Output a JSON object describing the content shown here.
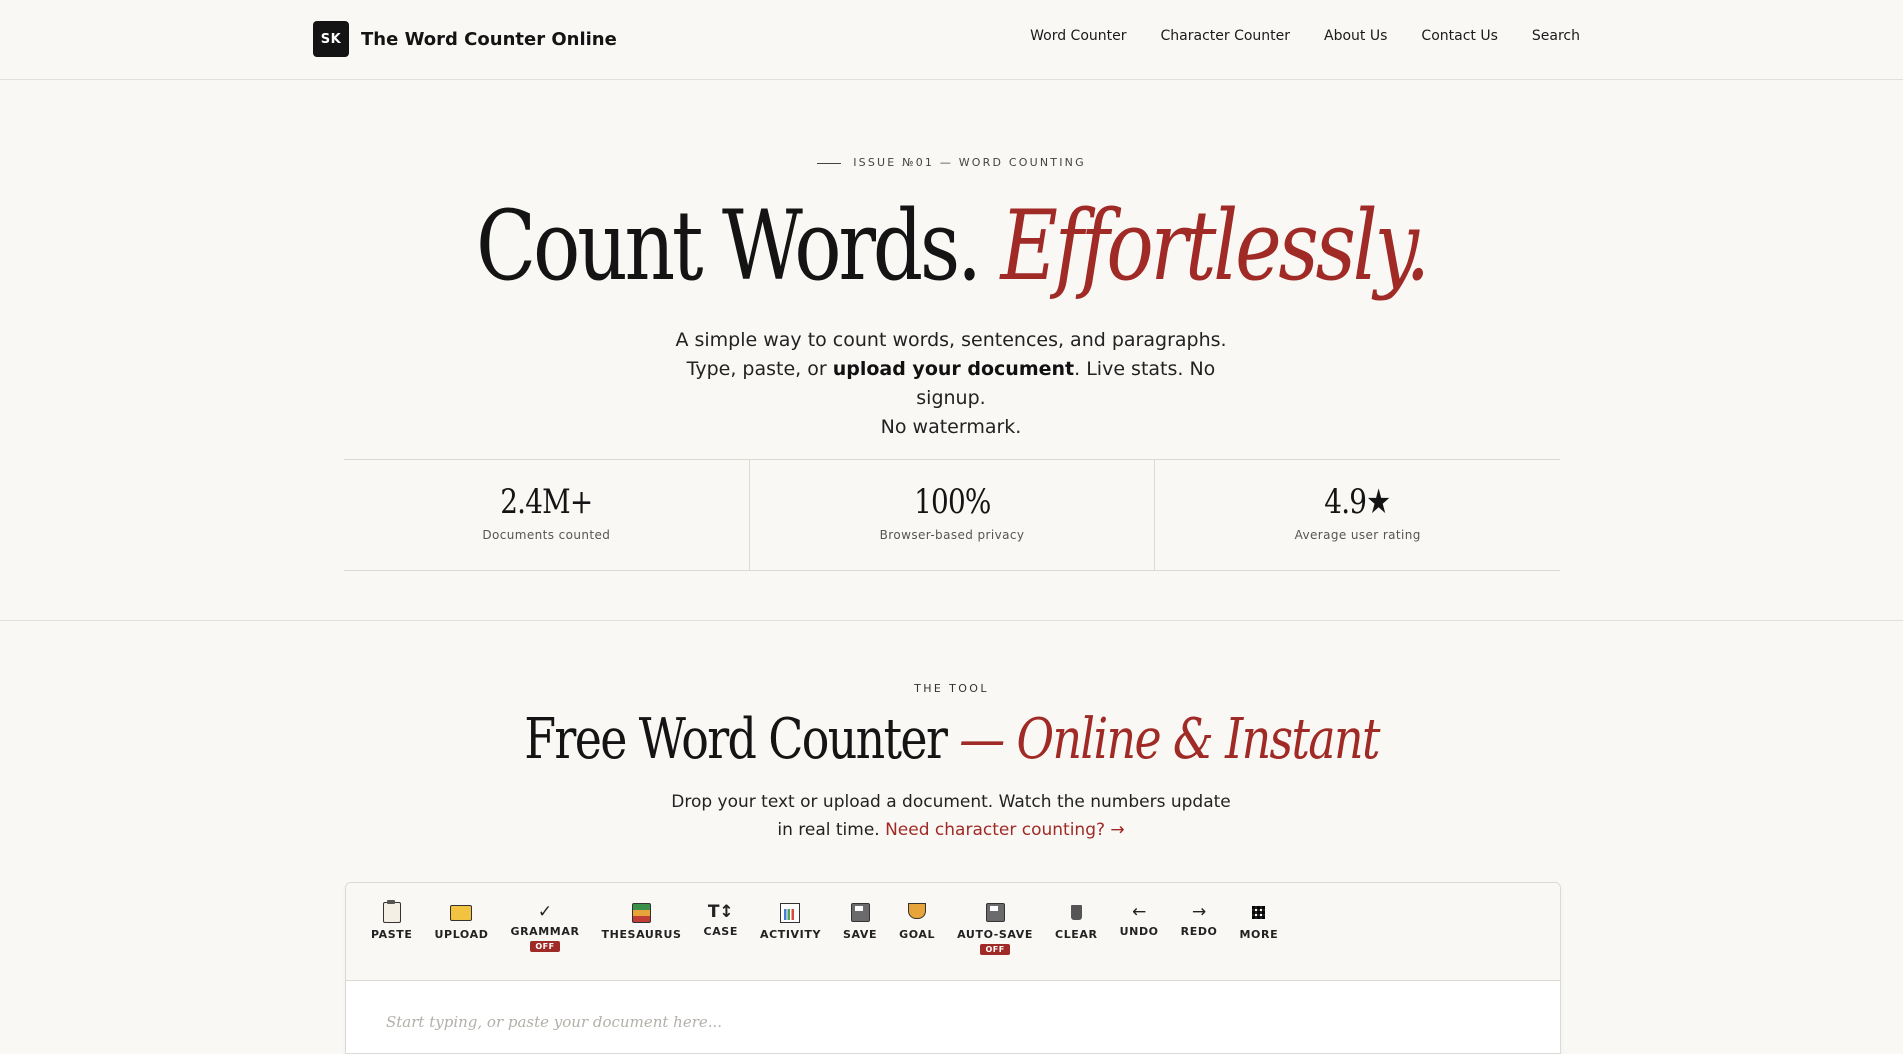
{
  "header": {
    "logo_text": "SK",
    "site_name": "The Word Counter Online",
    "nav": [
      "Word Counter",
      "Character Counter",
      "About Us",
      "Contact Us",
      "Search"
    ]
  },
  "hero": {
    "eyebrow": "ISSUE №01 — WORD COUNTING",
    "title_main": "Count Words.",
    "title_accent": "Effortlessly.",
    "sub_line1": "A simple way to count words, sentences, and paragraphs.",
    "sub_line2_pre": "Type, paste, or ",
    "sub_line2_bold": "upload your document",
    "sub_line2_post": ". Live stats. No signup.",
    "sub_line3": "No watermark."
  },
  "stats": [
    {
      "value": "2.4M+",
      "label": "Documents counted"
    },
    {
      "value": "100%",
      "label": "Browser-based privacy"
    },
    {
      "value": "4.9★",
      "label": "Average user rating"
    }
  ],
  "tool": {
    "eyebrow": "THE TOOL",
    "title_main": "Free Word Counter",
    "title_accent": "— Online & Instant",
    "sub_text": "Drop your text or upload a document. Watch the numbers update in real time.",
    "sub_link": "Need character counting? →"
  },
  "toolbar": {
    "paste": "PASTE",
    "upload": "UPLOAD",
    "grammar": "GRAMMAR",
    "grammar_state": "OFF",
    "thesaurus": "THESAURUS",
    "case": "CASE",
    "case_icon": "T↕",
    "activity": "ACTIVITY",
    "save": "SAVE",
    "goal": "GOAL",
    "autosave": "AUTO-SAVE",
    "autosave_state": "OFF",
    "clear": "CLEAR",
    "undo": "UNDO",
    "redo": "REDO",
    "more": "MORE",
    "check_icon": "✓",
    "undo_icon": "←",
    "redo_icon": "→"
  },
  "editor": {
    "placeholder": "Start typing, or paste your document here..."
  },
  "colors": {
    "accent": "#a02a25",
    "background": "#f9f8f5",
    "ink": "#141414"
  }
}
